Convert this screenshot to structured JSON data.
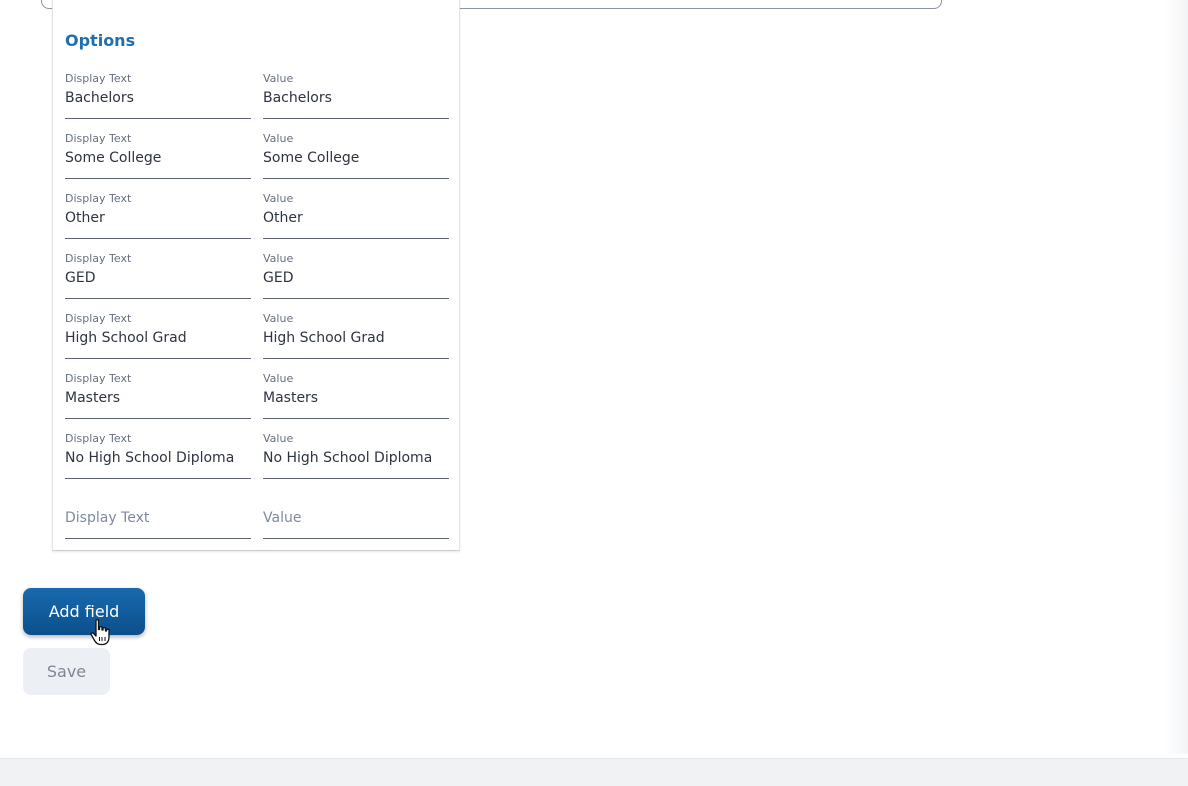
{
  "options": {
    "title": "Options",
    "rows": [
      {
        "display_label": "Display Text",
        "display_value": "Bachelors",
        "value_label": "Value",
        "value": "Bachelors"
      },
      {
        "display_label": "Display Text",
        "display_value": "Some College",
        "value_label": "Value",
        "value": "Some College"
      },
      {
        "display_label": "Display Text",
        "display_value": "Other",
        "value_label": "Value",
        "value": "Other"
      },
      {
        "display_label": "Display Text",
        "display_value": "GED",
        "value_label": "Value",
        "value": "GED"
      },
      {
        "display_label": "Display Text",
        "display_value": "High School Grad",
        "value_label": "Value",
        "value": "High School Grad"
      },
      {
        "display_label": "Display Text",
        "display_value": "Masters",
        "value_label": "Value",
        "value": "Masters"
      },
      {
        "display_label": "Display Text",
        "display_value": "No High School Diploma",
        "value_label": "Value",
        "value": "No High School Diploma"
      }
    ],
    "new_row": {
      "display_placeholder": "Display Text",
      "value_placeholder": "Value"
    }
  },
  "actions": {
    "add_field_label": "Add field",
    "save_label": "Save"
  },
  "colors": {
    "accent": "#1f6fb0",
    "primary_button": "#0f5a9c",
    "disabled_button": "#eceff3"
  },
  "icons": {
    "cursor": "hand-pointer-icon"
  }
}
